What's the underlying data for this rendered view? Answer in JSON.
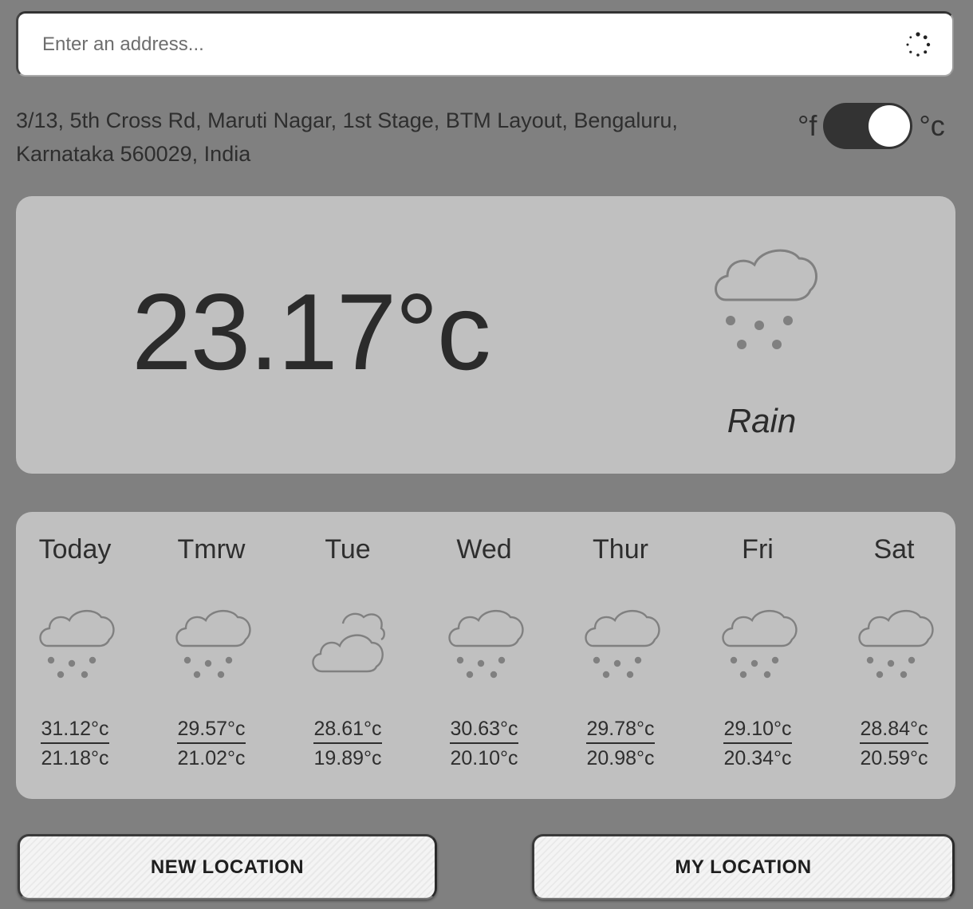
{
  "search": {
    "placeholder": "Enter an address...",
    "value": ""
  },
  "location": {
    "address": "3/13, 5th Cross Rd, Maruti Nagar, 1st Stage, BTM Layout, Bengaluru, Karnataka 560029, India"
  },
  "units": {
    "fahrenheit_label": "°f",
    "celsius_label": "°c",
    "selected": "celsius"
  },
  "current": {
    "temperature": "23.17°c",
    "condition": "Rain",
    "icon": "rain-cloud-icon"
  },
  "forecast": [
    {
      "day": "Today",
      "high": "31.12°c",
      "low": "21.18°c",
      "icon": "rain-cloud-icon"
    },
    {
      "day": "Tmrw",
      "high": "29.57°c",
      "low": "21.02°c",
      "icon": "rain-cloud-icon"
    },
    {
      "day": "Tue",
      "high": "28.61°c",
      "low": "19.89°c",
      "icon": "cloudy-icon"
    },
    {
      "day": "Wed",
      "high": "30.63°c",
      "low": "20.10°c",
      "icon": "rain-cloud-icon"
    },
    {
      "day": "Thur",
      "high": "29.78°c",
      "low": "20.98°c",
      "icon": "rain-cloud-icon"
    },
    {
      "day": "Fri",
      "high": "29.10°c",
      "low": "20.34°c",
      "icon": "rain-cloud-icon"
    },
    {
      "day": "Sat",
      "high": "28.84°c",
      "low": "20.59°c",
      "icon": "rain-cloud-icon"
    }
  ],
  "buttons": {
    "new_location": "NEW LOCATION",
    "my_location": "MY LOCATION"
  },
  "colors": {
    "background": "#808080",
    "card": "#c0c0c0",
    "text": "#2e2e2e",
    "icon": "#808080"
  }
}
